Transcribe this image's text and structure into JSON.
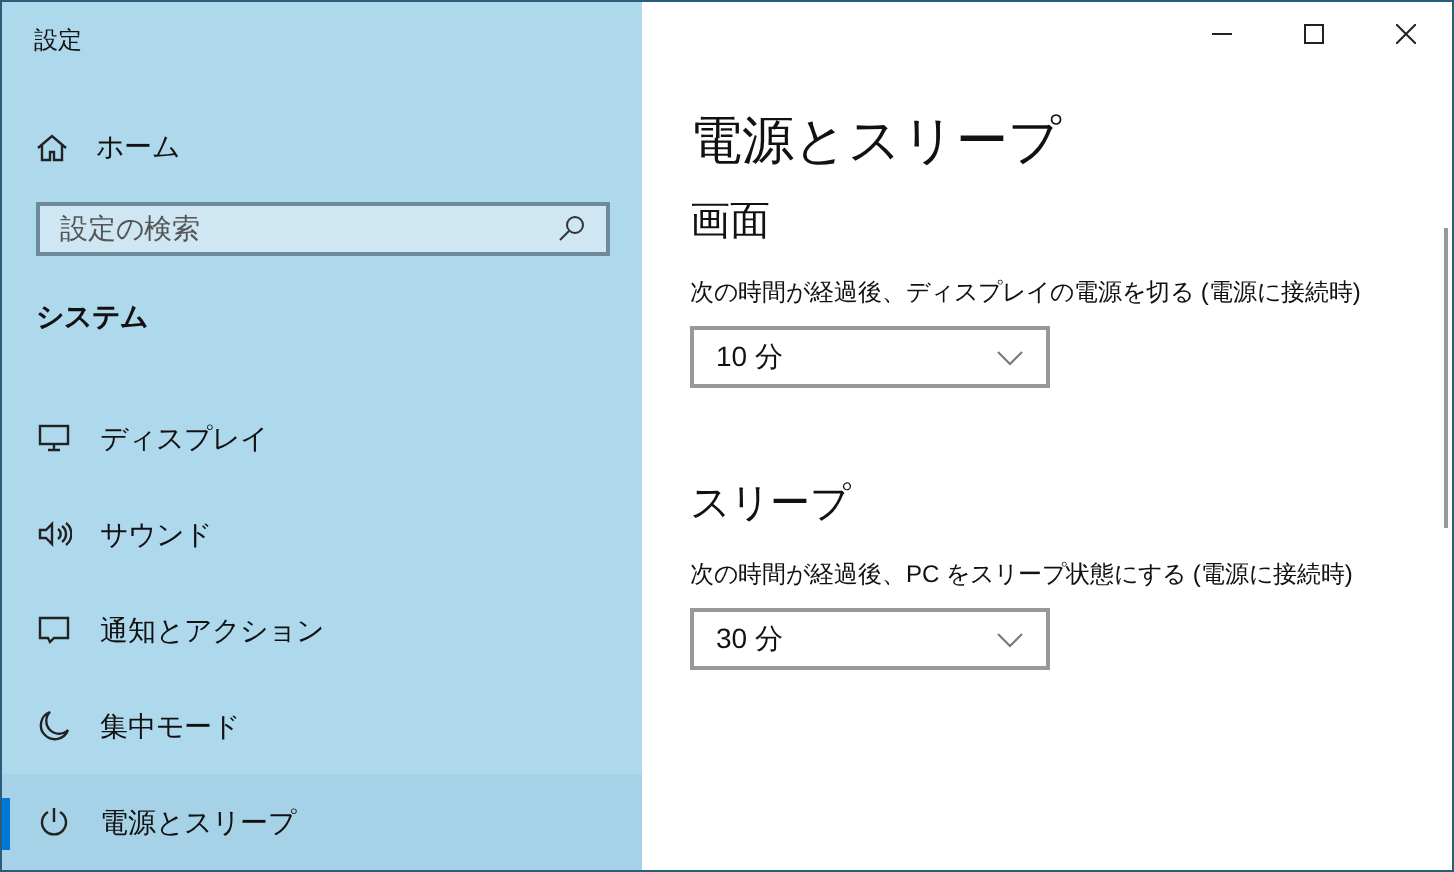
{
  "window": {
    "title": "設定"
  },
  "sidebar": {
    "home": "ホーム",
    "search": {
      "placeholder": "設定の検索"
    },
    "section": "システム",
    "items": [
      {
        "label": "ディスプレイ",
        "kind": "display",
        "selected": false
      },
      {
        "label": "サウンド",
        "kind": "sound",
        "selected": false
      },
      {
        "label": "通知とアクション",
        "kind": "notification",
        "selected": false
      },
      {
        "label": "集中モード",
        "kind": "focus",
        "selected": false
      },
      {
        "label": "電源とスリープ",
        "kind": "power",
        "selected": true
      }
    ]
  },
  "content": {
    "title": "電源とスリープ",
    "sections": [
      {
        "heading": "画面",
        "label": "次の時間が経過後、ディスプレイの電源を切る (電源に接続時)",
        "value": "10 分"
      },
      {
        "heading": "スリープ",
        "label": "次の時間が経過後、PC をスリープ状態にする (電源に接続時)",
        "value": "30 分"
      }
    ]
  }
}
